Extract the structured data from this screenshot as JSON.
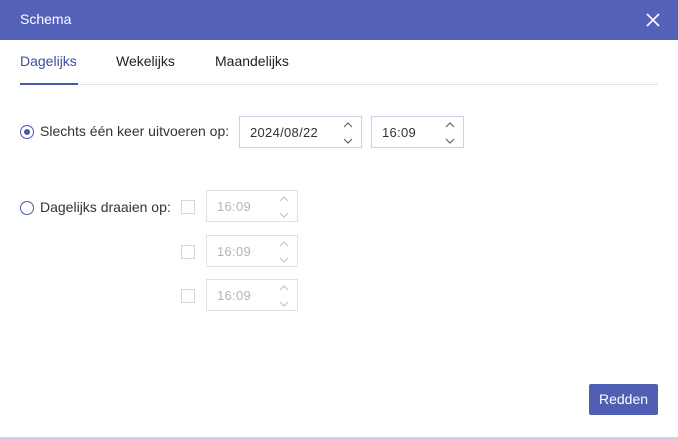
{
  "dialog": {
    "title": "Schema"
  },
  "tabs": [
    {
      "label": "Dagelijks"
    },
    {
      "label": "Wekelijks"
    },
    {
      "label": "Maandelijks"
    }
  ],
  "once": {
    "label": "Slechts één keer uitvoeren op:",
    "date": "2024/08/22",
    "time": "16:09",
    "selected": true
  },
  "daily": {
    "label": "Dagelijks draaien op:",
    "selected": false,
    "times": [
      "16:09",
      "16:09",
      "16:09"
    ]
  },
  "actions": {
    "save_label": "Redden"
  },
  "colors": {
    "accent": "#5461b8",
    "button": "#4f5fb4"
  }
}
